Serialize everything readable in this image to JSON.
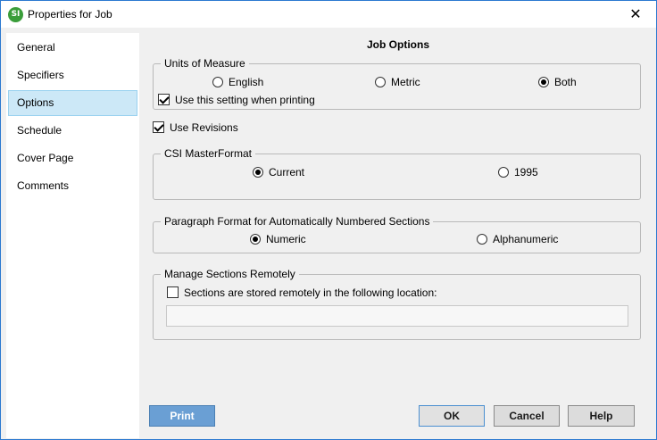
{
  "window": {
    "title": "Properties for Job",
    "icon_text": "SI",
    "close_glyph": "✕"
  },
  "sidebar": {
    "items": [
      {
        "label": "General",
        "selected": false
      },
      {
        "label": "Specifiers",
        "selected": false
      },
      {
        "label": "Options",
        "selected": true
      },
      {
        "label": "Schedule",
        "selected": false
      },
      {
        "label": "Cover Page",
        "selected": false
      },
      {
        "label": "Comments",
        "selected": false
      }
    ]
  },
  "main": {
    "heading": "Job Options",
    "units": {
      "legend": "Units of Measure",
      "options": [
        {
          "label": "English",
          "selected": false
        },
        {
          "label": "Metric",
          "selected": false
        },
        {
          "label": "Both",
          "selected": true
        }
      ],
      "use_when_printing": {
        "label": "Use this setting when printing",
        "checked": true
      }
    },
    "use_revisions": {
      "label": "Use Revisions",
      "checked": true
    },
    "csi": {
      "legend": "CSI MasterFormat",
      "options": [
        {
          "label": "Current",
          "selected": true
        },
        {
          "label": "1995",
          "selected": false
        }
      ]
    },
    "paragraph": {
      "legend": "Paragraph Format for Automatically Numbered Sections",
      "options": [
        {
          "label": "Numeric",
          "selected": true
        },
        {
          "label": "Alphanumeric",
          "selected": false
        }
      ]
    },
    "remote": {
      "legend": "Manage Sections Remotely",
      "stored_remotely": {
        "label": "Sections are stored remotely in the following location:",
        "checked": false
      },
      "location_value": ""
    }
  },
  "footer": {
    "print_label": "Print",
    "ok_label": "OK",
    "cancel_label": "Cancel",
    "help_label": "Help"
  }
}
